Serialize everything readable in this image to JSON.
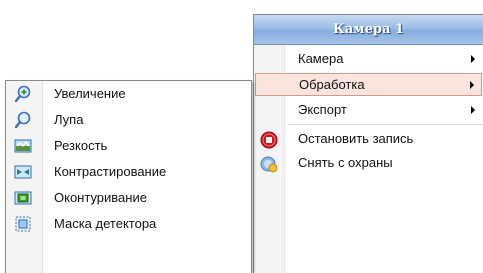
{
  "main_menu": {
    "title": "Камера 1",
    "items": [
      {
        "label": "Камера",
        "icon": "",
        "submenu": true
      },
      {
        "label": "Обработка",
        "icon": "",
        "submenu": true,
        "selected": true
      },
      {
        "label": "Экспорт",
        "icon": "",
        "submenu": true
      },
      {
        "label": "Остановить запись",
        "icon": "stop-record-icon",
        "submenu": false
      },
      {
        "label": "Снять с охраны",
        "icon": "disarm-icon",
        "submenu": false
      }
    ]
  },
  "processing_submenu": {
    "items": [
      {
        "label": "Увеличение",
        "icon": "zoom-in-icon"
      },
      {
        "label": "Лупа",
        "icon": "magnifier-icon"
      },
      {
        "label": "Резкость",
        "icon": "sharpness-icon"
      },
      {
        "label": "Контрастирование",
        "icon": "contrast-icon"
      },
      {
        "label": "Оконтуривание",
        "icon": "contour-icon"
      },
      {
        "label": "Маска детектора",
        "icon": "detector-mask-icon"
      }
    ]
  },
  "colors": {
    "header_gradient": "#86acdf",
    "selected_bg": "#fbe3de",
    "selected_border": "#d69a8c",
    "stop_icon": "#d2141c"
  }
}
